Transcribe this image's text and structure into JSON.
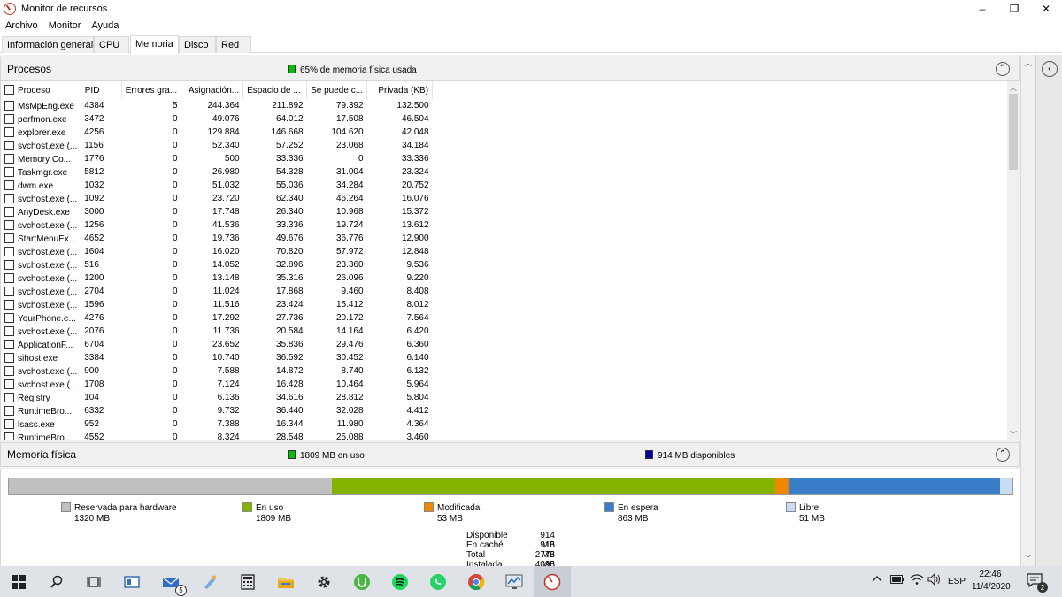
{
  "window": {
    "title": "Monitor de recursos",
    "minimize": "–",
    "maximize": "❐",
    "close": "✕"
  },
  "menu": [
    "Archivo",
    "Monitor",
    "Ayuda"
  ],
  "tabs": [
    "Información general",
    "CPU",
    "Memoria",
    "Disco",
    "Red"
  ],
  "active_tab": "Memoria",
  "procesos": {
    "title": "Procesos",
    "status": "65% de memoria física usada",
    "status_color": "#00c000",
    "columns": [
      "Proceso",
      "PID",
      "Errores gra...",
      "Asignación...",
      "Espacio de ...",
      "Se puede c...",
      "Privada (KB)"
    ],
    "rows": [
      [
        "MsMpEng.exe",
        "4384",
        "5",
        "244.364",
        "211.892",
        "79.392",
        "132.500"
      ],
      [
        "perfmon.exe",
        "3472",
        "0",
        "49.076",
        "64.012",
        "17.508",
        "46.504"
      ],
      [
        "explorer.exe",
        "4256",
        "0",
        "129.884",
        "146.668",
        "104.620",
        "42.048"
      ],
      [
        "svchost.exe (...",
        "1156",
        "0",
        "52.340",
        "57.252",
        "23.068",
        "34.184"
      ],
      [
        "Memory Co...",
        "1776",
        "0",
        "500",
        "33.336",
        "0",
        "33.336"
      ],
      [
        "Taskmgr.exe",
        "5812",
        "0",
        "26.980",
        "54.328",
        "31.004",
        "23.324"
      ],
      [
        "dwm.exe",
        "1032",
        "0",
        "51.032",
        "55.036",
        "34.284",
        "20.752"
      ],
      [
        "svchost.exe (...",
        "1092",
        "0",
        "23.720",
        "62.340",
        "46.264",
        "16.076"
      ],
      [
        "AnyDesk.exe",
        "3000",
        "0",
        "17.748",
        "26.340",
        "10.968",
        "15.372"
      ],
      [
        "svchost.exe (...",
        "1256",
        "0",
        "41.536",
        "33.336",
        "19.724",
        "13.612"
      ],
      [
        "StartMenuEx...",
        "4652",
        "0",
        "19.736",
        "49.676",
        "36.776",
        "12.900"
      ],
      [
        "svchost.exe (...",
        "1604",
        "0",
        "16.020",
        "70.820",
        "57.972",
        "12.848"
      ],
      [
        "svchost.exe (...",
        "516",
        "0",
        "14.052",
        "32.896",
        "23.360",
        "9.536"
      ],
      [
        "svchost.exe (...",
        "1200",
        "0",
        "13.148",
        "35.316",
        "26.096",
        "9.220"
      ],
      [
        "svchost.exe (...",
        "2704",
        "0",
        "11.024",
        "17.868",
        "9.460",
        "8.408"
      ],
      [
        "svchost.exe (...",
        "1596",
        "0",
        "11.516",
        "23.424",
        "15.412",
        "8.012"
      ],
      [
        "YourPhone.e...",
        "4276",
        "0",
        "17.292",
        "27.736",
        "20.172",
        "7.564"
      ],
      [
        "svchost.exe (...",
        "2076",
        "0",
        "11.736",
        "20.584",
        "14.164",
        "6.420"
      ],
      [
        "ApplicationF...",
        "6704",
        "0",
        "23.652",
        "35.836",
        "29.476",
        "6.360"
      ],
      [
        "sihost.exe",
        "3384",
        "0",
        "10.740",
        "36.592",
        "30.452",
        "6.140"
      ],
      [
        "svchost.exe (...",
        "900",
        "0",
        "7.588",
        "14.872",
        "8.740",
        "6.132"
      ],
      [
        "svchost.exe (...",
        "1708",
        "0",
        "7.124",
        "16.428",
        "10.464",
        "5.964"
      ],
      [
        "Registry",
        "104",
        "0",
        "6.136",
        "34.616",
        "28.812",
        "5.804"
      ],
      [
        "RuntimeBro...",
        "6332",
        "0",
        "9.732",
        "36.440",
        "32.028",
        "4.412"
      ],
      [
        "lsass.exe",
        "952",
        "0",
        "7.388",
        "16.344",
        "11.980",
        "4.364"
      ],
      [
        "RuntimeBro...",
        "4552",
        "0",
        "8.324",
        "28.548",
        "25.088",
        "3.460"
      ]
    ]
  },
  "memoria_fisica": {
    "title": "Memoria física",
    "in_use": "1809 MB en uso",
    "in_use_color": "#00c000",
    "available": "914 MB disponibles",
    "available_color": "#0000a0",
    "bar": [
      {
        "label": "Reservada para hardware",
        "value": "1320 MB",
        "mb": 1320,
        "color": "#c0c0c0"
      },
      {
        "label": "En uso",
        "value": "1809 MB",
        "mb": 1809,
        "color": "#85b300"
      },
      {
        "label": "Modificada",
        "value": "53 MB",
        "mb": 53,
        "color": "#ee8800"
      },
      {
        "label": "En espera",
        "value": "863 MB",
        "mb": 863,
        "color": "#3a7dc9"
      },
      {
        "label": "Libre",
        "value": "51 MB",
        "mb": 51,
        "color": "#c8dcf2"
      }
    ],
    "summary": [
      {
        "label": "Disponible",
        "value": "914 MB"
      },
      {
        "label": "En caché",
        "value": "916 MB"
      },
      {
        "label": "Total",
        "value": "2776 MB"
      },
      {
        "label": "Instalada",
        "value": "4096 MB"
      }
    ]
  },
  "taskbar": {
    "mail_badge": "5",
    "language": "ESP",
    "time": "22:46",
    "date": "11/4/2020",
    "notifications": "2"
  }
}
